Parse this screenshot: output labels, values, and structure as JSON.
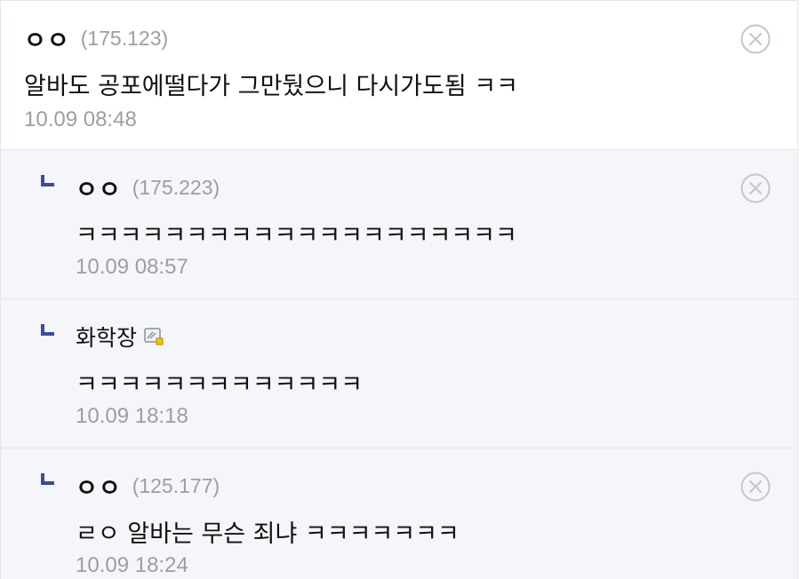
{
  "comments": [
    {
      "nick": "ㅇㅇ",
      "ip": "(175.123)",
      "text": "알바도 공포에떨다가 그만뒀으니 다시가도됨 ㅋㅋ",
      "date": "10.09 08:48"
    },
    {
      "nick": "ㅇㅇ",
      "ip": "(175.223)",
      "text": "ㅋㅋㅋㅋㅋㅋㅋㅋㅋㅋㅋㅋㅋㅋㅋㅋㅋㅋㅋㅋ",
      "date": "10.09 08:57"
    },
    {
      "nick": "화학장",
      "text": "ㅋㅋㅋㅋㅋㅋㅋㅋㅋㅋㅋㅋㅋ",
      "date": "10.09 18:18"
    },
    {
      "nick": "ㅇㅇ",
      "ip": "(125.177)",
      "text": "ㄹㅇ 알바는 무슨 죄냐 ㅋㅋㅋㅋㅋㅋㅋ",
      "date": "10.09 18:24"
    }
  ],
  "icons": {
    "delete": "close-circle-icon",
    "reply": "reply-arrow-icon",
    "user_badge": "fixed-nick-icon"
  },
  "colors": {
    "reply_mark": "#3b4aa0",
    "reply_bg": "#f5f6fa",
    "meta_gray": "#9b9ea4",
    "badge_yellow": "#f2c200"
  }
}
